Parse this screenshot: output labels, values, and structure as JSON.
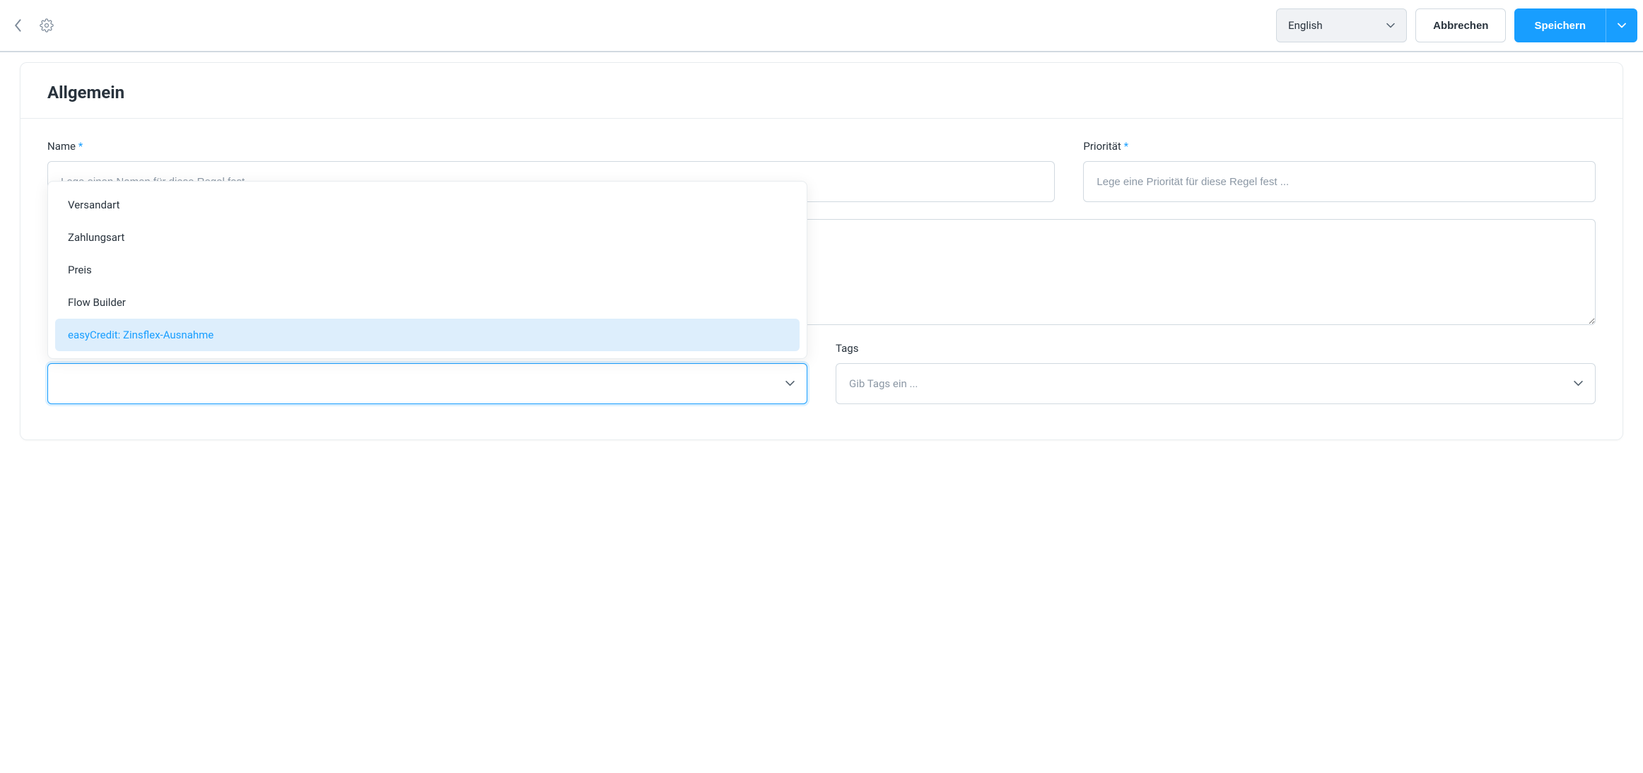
{
  "header": {
    "language": "English",
    "cancel_label": "Abbrechen",
    "save_label": "Speichern"
  },
  "card": {
    "title": "Allgemein"
  },
  "fields": {
    "name": {
      "label": "Name",
      "placeholder": "Lege einen Namen für diese Regel fest ..."
    },
    "priority": {
      "label": "Priorität",
      "placeholder": "Lege eine Priorität für diese Regel fest ..."
    },
    "tags": {
      "label": "Tags",
      "placeholder": "Gib Tags ein ..."
    }
  },
  "dropdown": {
    "items": [
      {
        "label": "Versandart",
        "highlighted": false
      },
      {
        "label": "Zahlungsart",
        "highlighted": false
      },
      {
        "label": "Preis",
        "highlighted": false
      },
      {
        "label": "Flow Builder",
        "highlighted": false
      },
      {
        "label": "easyCredit: Zinsflex-Ausnahme",
        "highlighted": true
      }
    ]
  }
}
